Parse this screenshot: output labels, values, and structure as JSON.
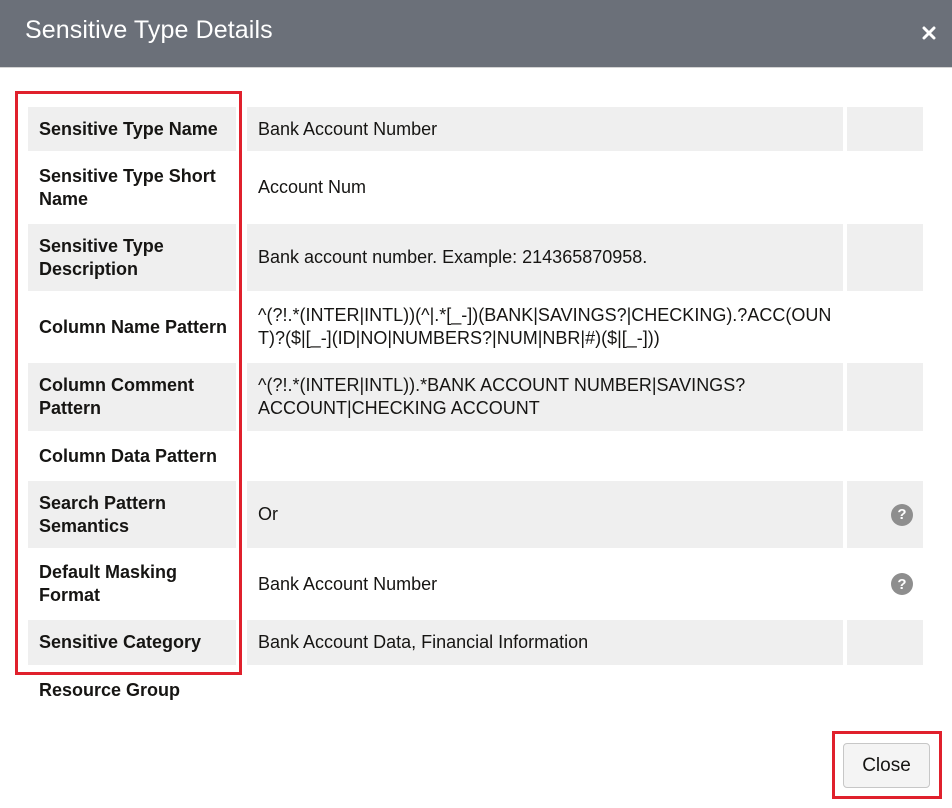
{
  "dialog": {
    "title": "Sensitive Type Details",
    "close_icon": "close-icon"
  },
  "rows": [
    {
      "label": "Sensitive Type Name",
      "value": "Bank Account Number",
      "help": false
    },
    {
      "label": "Sensitive Type Short Name",
      "value": "Account Num",
      "help": false
    },
    {
      "label": "Sensitive Type Description",
      "value": "Bank account number. Example: 214365870958.",
      "help": false
    },
    {
      "label": "Column Name Pattern",
      "value": "^(?!.*(INTER|INTL))(^|.*[_-])(BANK|SAVINGS?|CHECKING).?ACC(OUNT)?($|[_-](ID|NO|NUMBERS?|NUM|NBR|#)($|[_-]))",
      "help": false
    },
    {
      "label": "Column Comment Pattern",
      "value": "^(?!.*(INTER|INTL)).*BANK ACCOUNT NUMBER|SAVINGS? ACCOUNT|CHECKING ACCOUNT",
      "help": false
    },
    {
      "label": "Column Data Pattern",
      "value": "",
      "help": false
    },
    {
      "label": "Search Pattern Semantics",
      "value": "Or",
      "help": true,
      "help_icon": "question-circle-icon"
    },
    {
      "label": "Default Masking Format",
      "value": "Bank Account Number",
      "help": true,
      "help_icon": "question-circle-icon"
    },
    {
      "label": "Sensitive Category",
      "value": "Bank Account Data, Financial Information",
      "help": false
    },
    {
      "label": "Resource Group",
      "value": "",
      "help": false
    }
  ],
  "footer": {
    "close_label": "Close"
  },
  "colors": {
    "header_bg": "#6b7079",
    "row_shade": "#efefef",
    "highlight": "#e0202c"
  }
}
